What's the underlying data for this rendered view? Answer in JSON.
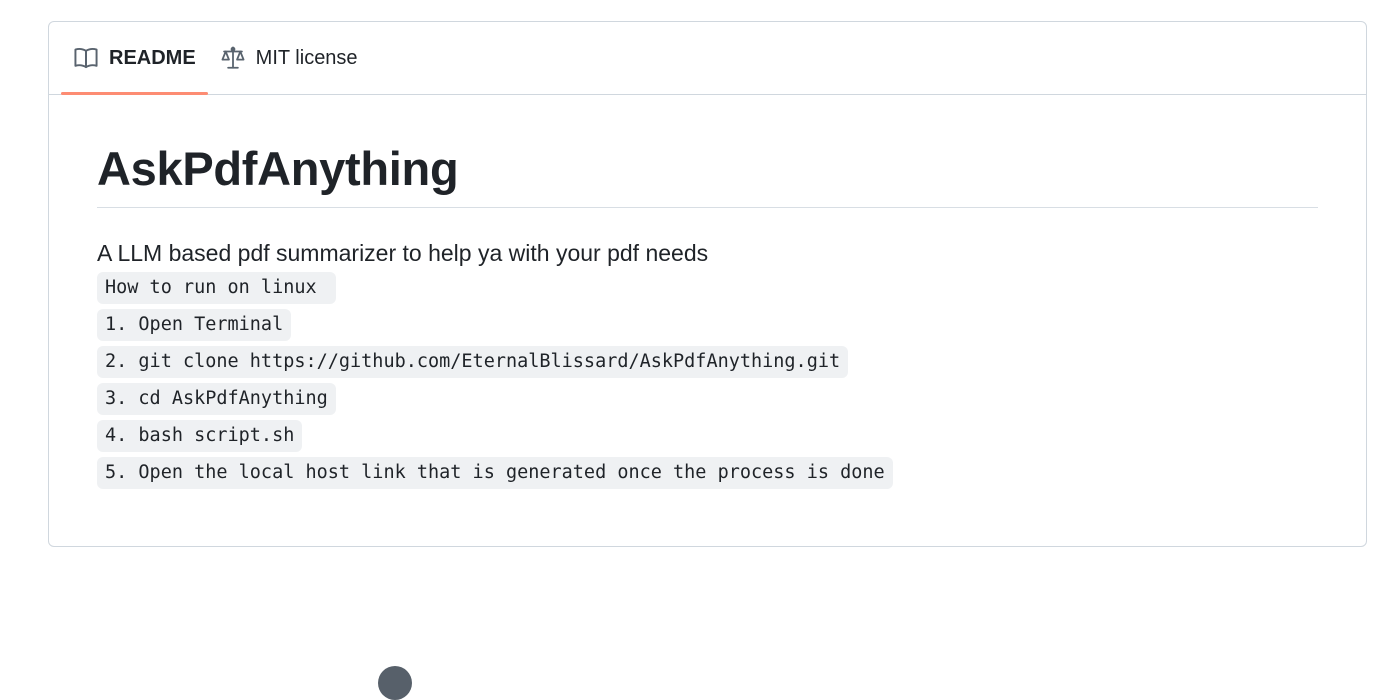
{
  "tabs": [
    {
      "label": "README",
      "icon": "book-icon",
      "selected": true
    },
    {
      "label": "MIT license",
      "icon": "scale-icon",
      "selected": false
    }
  ],
  "readme": {
    "title": "AskPdfAnything",
    "description": "A LLM based pdf summarizer to help ya with your pdf needs",
    "code_lines": [
      "How to run on linux ",
      "1. Open Terminal",
      "2. git clone https://github.com/EternalBlissard/AskPdfAnything.git",
      "3. cd AskPdfAnything",
      "4. bash script.sh",
      "5. Open the local host link that is generated once the process is done"
    ]
  },
  "colors": {
    "selected_tab_underline": "#fd8c73",
    "border": "#d0d7de",
    "code_background": "#eff1f3",
    "text": "#1f2328"
  }
}
